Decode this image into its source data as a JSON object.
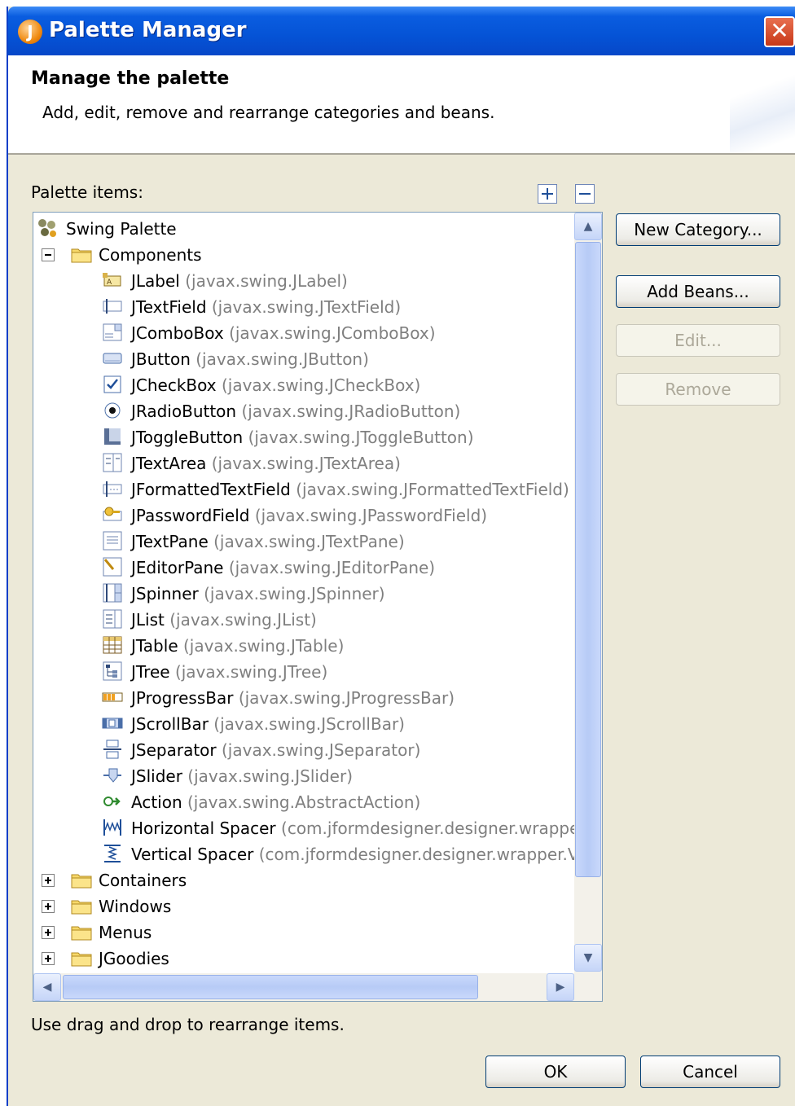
{
  "window": {
    "title": "Palette Manager",
    "close_label": "✕"
  },
  "header": {
    "title": "Manage the palette",
    "description": "Add, edit, remove and rearrange categories and beans."
  },
  "palette_items_label": "Palette items:",
  "tree": {
    "root": "Swing Palette",
    "components_label": "Components",
    "components": [
      {
        "name": "JLabel",
        "pkg": "(javax.swing.JLabel)",
        "icon": "label-icon"
      },
      {
        "name": "JTextField",
        "pkg": "(javax.swing.JTextField)",
        "icon": "textfield-icon"
      },
      {
        "name": "JComboBox",
        "pkg": "(javax.swing.JComboBox)",
        "icon": "combobox-icon"
      },
      {
        "name": "JButton",
        "pkg": "(javax.swing.JButton)",
        "icon": "button-icon"
      },
      {
        "name": "JCheckBox",
        "pkg": "(javax.swing.JCheckBox)",
        "icon": "checkbox-icon"
      },
      {
        "name": "JRadioButton",
        "pkg": "(javax.swing.JRadioButton)",
        "icon": "radiobutton-icon"
      },
      {
        "name": "JToggleButton",
        "pkg": "(javax.swing.JToggleButton)",
        "icon": "togglebutton-icon"
      },
      {
        "name": "JTextArea",
        "pkg": "(javax.swing.JTextArea)",
        "icon": "textarea-icon"
      },
      {
        "name": "JFormattedTextField",
        "pkg": "(javax.swing.JFormattedTextField)",
        "icon": "formattedtextfield-icon"
      },
      {
        "name": "JPasswordField",
        "pkg": "(javax.swing.JPasswordField)",
        "icon": "passwordfield-icon"
      },
      {
        "name": "JTextPane",
        "pkg": "(javax.swing.JTextPane)",
        "icon": "textpane-icon"
      },
      {
        "name": "JEditorPane",
        "pkg": "(javax.swing.JEditorPane)",
        "icon": "editorpane-icon"
      },
      {
        "name": "JSpinner",
        "pkg": "(javax.swing.JSpinner)",
        "icon": "spinner-icon"
      },
      {
        "name": "JList",
        "pkg": "(javax.swing.JList)",
        "icon": "list-icon"
      },
      {
        "name": "JTable",
        "pkg": "(javax.swing.JTable)",
        "icon": "table-icon"
      },
      {
        "name": "JTree",
        "pkg": "(javax.swing.JTree)",
        "icon": "tree-icon"
      },
      {
        "name": "JProgressBar",
        "pkg": "(javax.swing.JProgressBar)",
        "icon": "progressbar-icon"
      },
      {
        "name": "JScrollBar",
        "pkg": "(javax.swing.JScrollBar)",
        "icon": "scrollbar-icon"
      },
      {
        "name": "JSeparator",
        "pkg": "(javax.swing.JSeparator)",
        "icon": "separator-icon"
      },
      {
        "name": "JSlider",
        "pkg": "(javax.swing.JSlider)",
        "icon": "slider-icon"
      },
      {
        "name": "Action",
        "pkg": "(javax.swing.AbstractAction)",
        "icon": "action-icon"
      },
      {
        "name": "Horizontal Spacer",
        "pkg": "(com.jformdesigner.designer.wrapper",
        "icon": "horizontal-spacer-icon"
      },
      {
        "name": "Vertical Spacer",
        "pkg": "(com.jformdesigner.designer.wrapper.V",
        "icon": "vertical-spacer-icon"
      }
    ],
    "categories": [
      "Containers",
      "Windows",
      "Menus",
      "JGoodies"
    ]
  },
  "buttons": {
    "new_category": "New Category...",
    "add_beans": "Add Beans...",
    "edit": "Edit...",
    "remove": "Remove",
    "ok": "OK",
    "cancel": "Cancel"
  },
  "footer_hint": "Use drag and drop to rearrange items.",
  "colors": {
    "titlebar": "#0553d6",
    "dialog_bg": "#ece9d8",
    "package_text": "#7f7f7f"
  }
}
